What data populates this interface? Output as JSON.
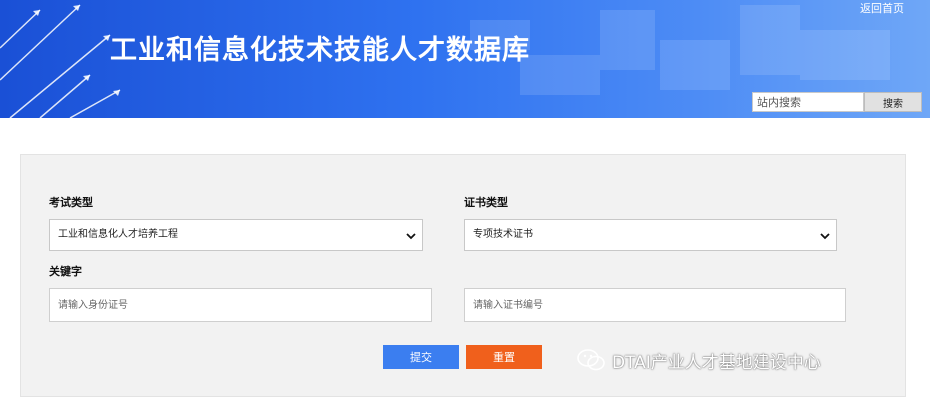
{
  "header": {
    "title": "工业和信息化技术技能人才数据库",
    "back_home_link": "返回首页",
    "site_search": {
      "placeholder": "站内搜索",
      "button_label": "搜索"
    },
    "colors": {
      "banner_start": "#1a50d6",
      "banner_end": "#6fa7f7"
    }
  },
  "form": {
    "exam_type": {
      "label": "考试类型",
      "selected": "工业和信息化人才培养工程"
    },
    "cert_type": {
      "label": "证书类型",
      "selected": "专项技术证书"
    },
    "keyword": {
      "label": "关键字",
      "id_placeholder": "请输入身份证号",
      "cert_no_placeholder": "请输入证书编号"
    },
    "buttons": {
      "submit_label": "提交",
      "reset_label": "重置",
      "submit_color": "#3b7ef0",
      "reset_color": "#f0601c"
    }
  },
  "watermark": {
    "icon": "wechat-icon",
    "text": "DTAI产业人才基地建设中心"
  }
}
